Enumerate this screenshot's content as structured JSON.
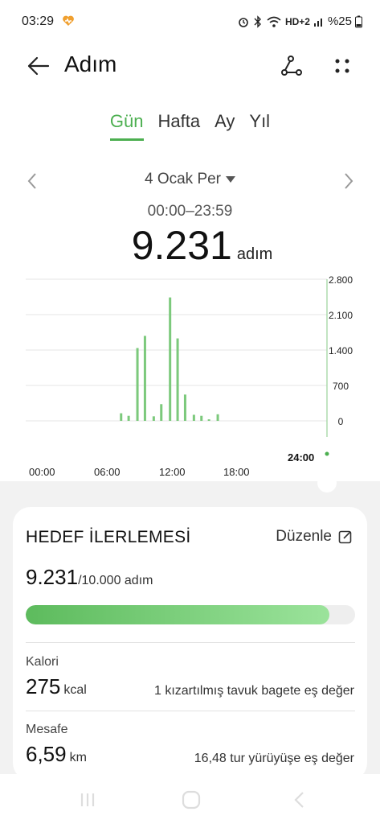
{
  "status": {
    "time": "03:29",
    "battery": "%25",
    "network": "HD+2"
  },
  "header": {
    "title": "Adım"
  },
  "tabs": [
    {
      "label": "Gün",
      "active": true
    },
    {
      "label": "Hafta",
      "active": false
    },
    {
      "label": "Ay",
      "active": false
    },
    {
      "label": "Yıl",
      "active": false
    }
  ],
  "date": {
    "selected": "4 Ocak Per",
    "range": "00:00–23:59"
  },
  "summary": {
    "steps": "9.231",
    "unit": "adım"
  },
  "chart_data": {
    "type": "bar",
    "title": "",
    "xlabel": "",
    "ylabel": "",
    "ylim": [
      0,
      2800
    ],
    "y_ticks": [
      "2.800",
      "2.100",
      "1.400",
      "700",
      "0"
    ],
    "x_ticks": [
      "00:00",
      "06:00",
      "12:00",
      "18:00"
    ],
    "now_label": "24:00",
    "series": [
      {
        "hours": [
          7.6,
          8.2,
          8.9,
          9.5,
          10.2,
          10.8,
          11.5,
          12.1,
          12.7,
          13.4,
          14.0,
          14.6,
          15.3
        ],
        "values": [
          150,
          100,
          1440,
          1680,
          90,
          330,
          2440,
          1630,
          520,
          120,
          100,
          30,
          130
        ]
      }
    ],
    "grid": true,
    "accent": "#7cc97c"
  },
  "goal": {
    "title": "HEDEF İLERLEMESİ",
    "edit_label": "Düzenle",
    "current": "9.231",
    "target_text": "/10.000 adım",
    "progress": 0.9231
  },
  "stats": {
    "calories": {
      "label": "Kalori",
      "value": "275",
      "unit": "kcal",
      "equivalent": "1 kızartılmış tavuk bagete eş değer"
    },
    "distance": {
      "label": "Mesafe",
      "value": "6,59",
      "unit": "km",
      "equivalent": "16,48 tur yürüyüşe eş değer"
    }
  },
  "colors": {
    "accent": "#4caf50",
    "bar": "#7cc97c"
  }
}
